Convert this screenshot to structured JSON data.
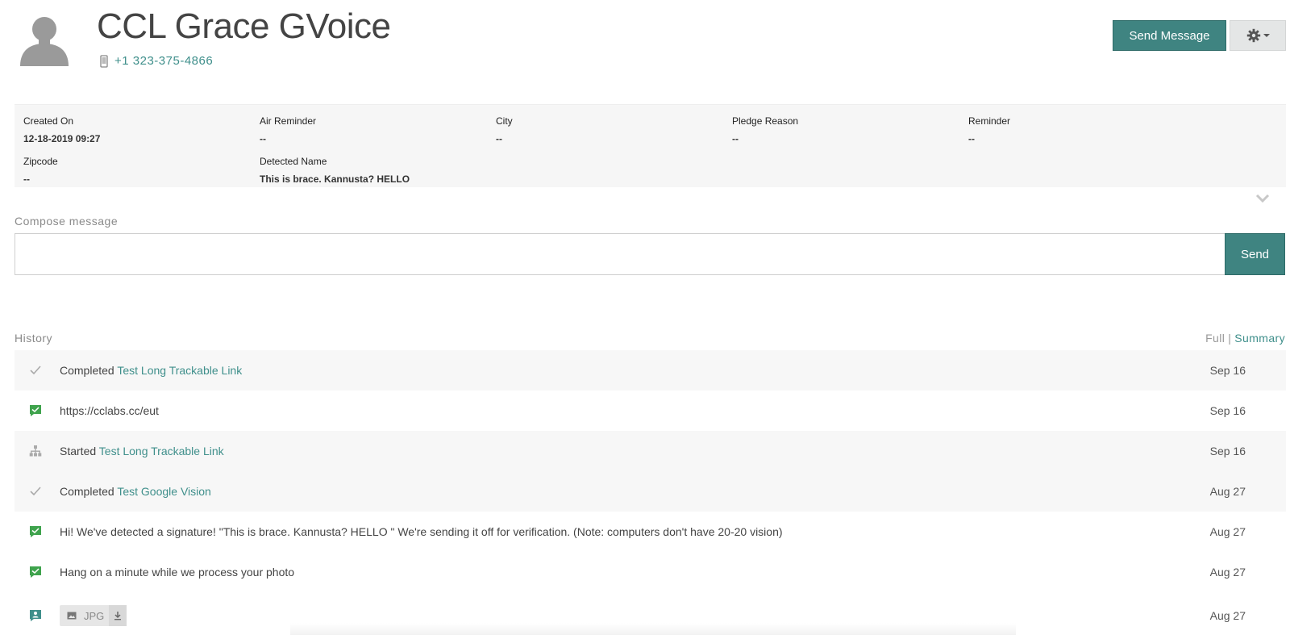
{
  "contact": {
    "name": "CCL Grace GVoice",
    "phone": "+1 323-375-4866"
  },
  "header_actions": {
    "send_message_label": "Send Message",
    "settings_icon": "gear-icon"
  },
  "fields": [
    {
      "label": "Created On",
      "value": "12-18-2019 09:27"
    },
    {
      "label": "Air Reminder",
      "value": "--"
    },
    {
      "label": "City",
      "value": "--"
    },
    {
      "label": "Pledge Reason",
      "value": "--"
    },
    {
      "label": "Reminder",
      "value": "--"
    },
    {
      "label": "Zipcode",
      "value": "--"
    },
    {
      "label": "Detected Name",
      "value": "This is brace. Kannusta? HELLO"
    }
  ],
  "compose": {
    "label": "Compose message",
    "value": "",
    "send_label": "Send"
  },
  "history": {
    "label": "History",
    "toggle_full": "Full",
    "toggle_separator": "|",
    "toggle_summary": "Summary",
    "items": [
      {
        "icon": "check-icon",
        "prefix": "Completed ",
        "link": "Test Long Trackable Link",
        "date": "Sep 16"
      },
      {
        "icon": "message-icon",
        "prefix": "https://cclabs.cc/eut",
        "link": "",
        "date": "Sep 16"
      },
      {
        "icon": "flow-icon",
        "prefix": "Started ",
        "link": "Test Long Trackable Link",
        "date": "Sep 16"
      },
      {
        "icon": "check-icon",
        "prefix": "Completed ",
        "link": "Test Google Vision",
        "date": "Aug 27"
      },
      {
        "icon": "message-icon",
        "prefix": "Hi! We've detected a signature! \"This is brace. Kannusta? HELLO \" We're sending it off for verification. (Note: computers don't have 20-20 vision)",
        "link": "",
        "date": "Aug 27"
      },
      {
        "icon": "message-icon",
        "prefix": "Hang on a minute while we process your photo",
        "link": "",
        "date": "Aug 27"
      },
      {
        "icon": "incoming-message-icon",
        "attachment_type": "JPG",
        "date": "Aug 27"
      }
    ]
  },
  "colors": {
    "accent": "#3f8481",
    "link": "#3f8f8b",
    "message_icon": "#3fa34d"
  }
}
